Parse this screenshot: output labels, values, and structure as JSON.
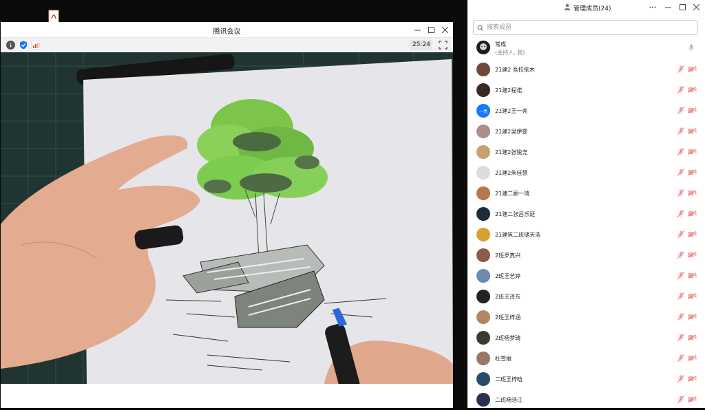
{
  "meeting": {
    "title": "腾讯会议",
    "timer": "25:24",
    "toolbar_icons": [
      "info-icon",
      "shield-icon",
      "signal-icon"
    ]
  },
  "members_panel": {
    "title": "管理成员(24)",
    "search_placeholder": "搜索成员",
    "host": {
      "name": "常成",
      "role": "(主持人, 我)"
    },
    "members": [
      {
        "name": "21建2  吾拉依木",
        "avatar_color": "#6b4a3a"
      },
      {
        "name": "21建2程诺",
        "avatar_color": "#3a2a22"
      },
      {
        "name": "21建2王一亮",
        "avatar_color": "#1677ff",
        "avatar_text": "一亮"
      },
      {
        "name": "21建2吴伊雯",
        "avatar_color": "#a89088"
      },
      {
        "name": "21建2张锐尧",
        "avatar_color": "#c9a070"
      },
      {
        "name": "21建2朱佳慧",
        "avatar_color": "#dcdcdc"
      },
      {
        "name": "21建二顾一琦",
        "avatar_color": "#b8774a"
      },
      {
        "name": "21建二张吕乐延",
        "avatar_color": "#1c2a3a"
      },
      {
        "name": "21建筑二班储天浩",
        "avatar_color": "#d8a030"
      },
      {
        "name": "2班罗真兴",
        "avatar_color": "#8a5a4a"
      },
      {
        "name": "2班王艺婷",
        "avatar_color": "#6a8ab0"
      },
      {
        "name": "2班王泽东",
        "avatar_color": "#222222"
      },
      {
        "name": "2班王梓涵",
        "avatar_color": "#b08860"
      },
      {
        "name": "2班杨梦琦",
        "avatar_color": "#3a3a30"
      },
      {
        "name": "杜雪丽",
        "avatar_color": "#9a7868"
      },
      {
        "name": "二班王梓晗",
        "avatar_color": "#2a4a6a"
      },
      {
        "name": "二班杨浩江",
        "avatar_color": "#2a3050"
      }
    ]
  },
  "colors": {
    "muted_icon": "#e26a6a",
    "accent": "#1677ff"
  }
}
